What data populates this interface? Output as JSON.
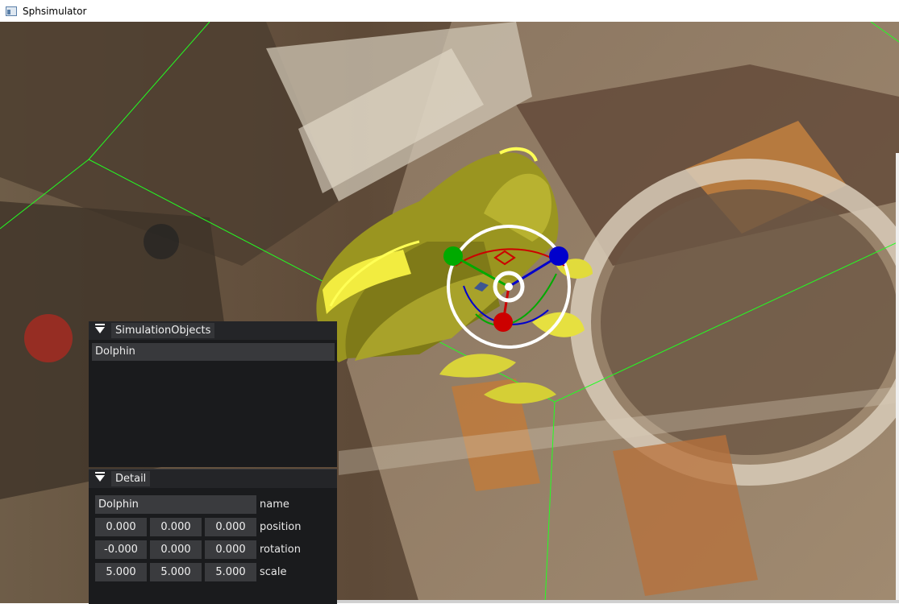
{
  "window": {
    "title": "Sphsimulator",
    "icon": "app-window-icon"
  },
  "simulation_objects": {
    "header": "SimulationObjects",
    "items": [
      "Dolphin"
    ]
  },
  "detail": {
    "header": "Detail",
    "name_value": "Dolphin",
    "name_label": "name",
    "position": {
      "label": "position",
      "values": [
        "0.000",
        "0.000",
        "0.000"
      ]
    },
    "rotation": {
      "label": "rotation",
      "values": [
        "-0.000",
        "0.000",
        "0.000"
      ]
    },
    "scale": {
      "label": "scale",
      "values": [
        "5.000",
        "5.000",
        "5.000"
      ]
    }
  },
  "colors": {
    "object": "#c8c22a",
    "grid_lines": "#22ff22",
    "gizmo_x": "#cc0000",
    "gizmo_y": "#00aa00",
    "gizmo_z": "#0000cc",
    "panel_bg": "#1a1b1d"
  }
}
